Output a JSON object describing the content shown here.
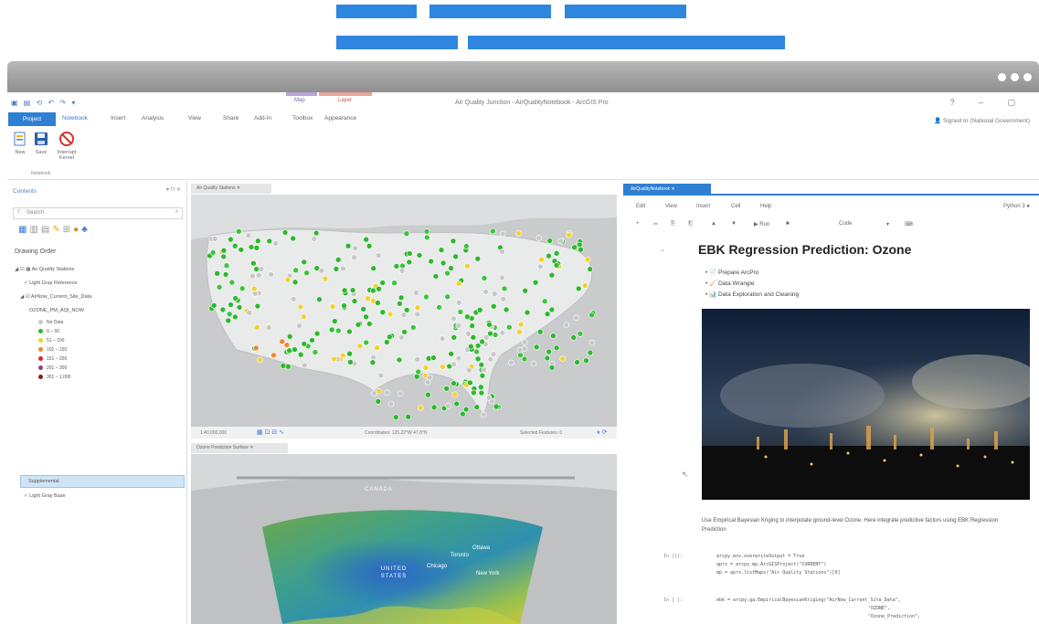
{
  "app": {
    "title": "Air Quality Junction - AirQualityNotebook - ArcGIS Pro",
    "signin": "Signed In (National Government)",
    "contextual_groups": [
      {
        "label": "Map",
        "color": "#b7a7d6"
      },
      {
        "label": "Layer",
        "color": "#e7a49a"
      }
    ]
  },
  "ribbon": {
    "tabs": [
      "Project",
      "Notebook",
      "Insert",
      "Analysis",
      "View",
      "Share",
      "Add-In",
      "Toolbox",
      "Appearance"
    ],
    "active_tab": "Notebook",
    "buttons": [
      {
        "label": "New",
        "icon": "new-notebook-icon"
      },
      {
        "label": "Save",
        "icon": "save-icon"
      },
      {
        "label": "Interrupt Kernel",
        "icon": "stop-icon"
      }
    ],
    "group_label": "Notebook"
  },
  "contents": {
    "title": "Contents",
    "search_placeholder": "Search",
    "drawing_order": "Drawing Order",
    "layers": [
      {
        "label": "Air Quality Stations",
        "indent": 0
      },
      {
        "label": "Light Gray Reference",
        "indent": 1
      },
      {
        "label": "AirNow_Current_Site_Data",
        "indent": 1
      },
      {
        "label": "OZONE_PM_AQI_NOW",
        "indent": 2
      }
    ],
    "legend": [
      {
        "label": "No Data",
        "color": "#c8c8c8"
      },
      {
        "label": "0 – 50",
        "color": "#2eb82e"
      },
      {
        "label": "51 – 100",
        "color": "#f2d22e"
      },
      {
        "label": "101 – 150",
        "color": "#f2872e"
      },
      {
        "label": "151 – 200",
        "color": "#e02424"
      },
      {
        "label": "201 – 300",
        "color": "#8e3b96"
      },
      {
        "label": "301 – 1,000",
        "color": "#7e1d1d"
      }
    ],
    "selected_layer": "Supplemental",
    "last_layer": "Light Gray Base"
  },
  "map1": {
    "tab_label": "Air Quality Stations",
    "status_scale": "1:40,000,000",
    "status_selected": "Selected Features: 0",
    "status_coords": "Coordinates: 125.22°W 47.8°N"
  },
  "map2": {
    "tab_label": "Ozone Prediction Surface",
    "labels": [
      "CANADA",
      "UNITED STATES",
      "Chicago",
      "Toronto",
      "Ottawa",
      "New York"
    ]
  },
  "notebook": {
    "tab_label": "AirQualityNotebook",
    "menu": [
      "Edit",
      "View",
      "Insert",
      "Cell",
      "Help"
    ],
    "kernel": "Python 3",
    "toolbar": [
      "+",
      "✂",
      "⎘",
      "⎗",
      "▲",
      "▼",
      "▶ Run",
      "■",
      "Code",
      "▾",
      "⌨"
    ],
    "title": "EBK Regression Prediction: Ozone",
    "toc": [
      "Prepare ArcPro",
      "Data Wrangle",
      "Data Exploration and Cleaning"
    ],
    "paragraph": "Use Empirical Bayesian Kriging to interpolate ground-level Ozone. Here integrate predictive factors using EBK Regression Prediction",
    "cells": [
      {
        "prompt": "In [1]:",
        "lines": [
          "arcpy.env.overwriteOutput = True",
          "aprx = arcpy.mp.ArcGISProject(\"CURRENT\")",
          "mp = aprx.listMaps(\"Air Quality Stations\")[0]"
        ]
      },
      {
        "prompt": "In [ ]:",
        "lines": [
          "ebk = arcpy.ga.EmpiricalBayesianKriging(\"AirNow_Current_Site_Data\",",
          "\"OZONE\",",
          "\"Ozone_Prediction\","
        ]
      }
    ]
  }
}
